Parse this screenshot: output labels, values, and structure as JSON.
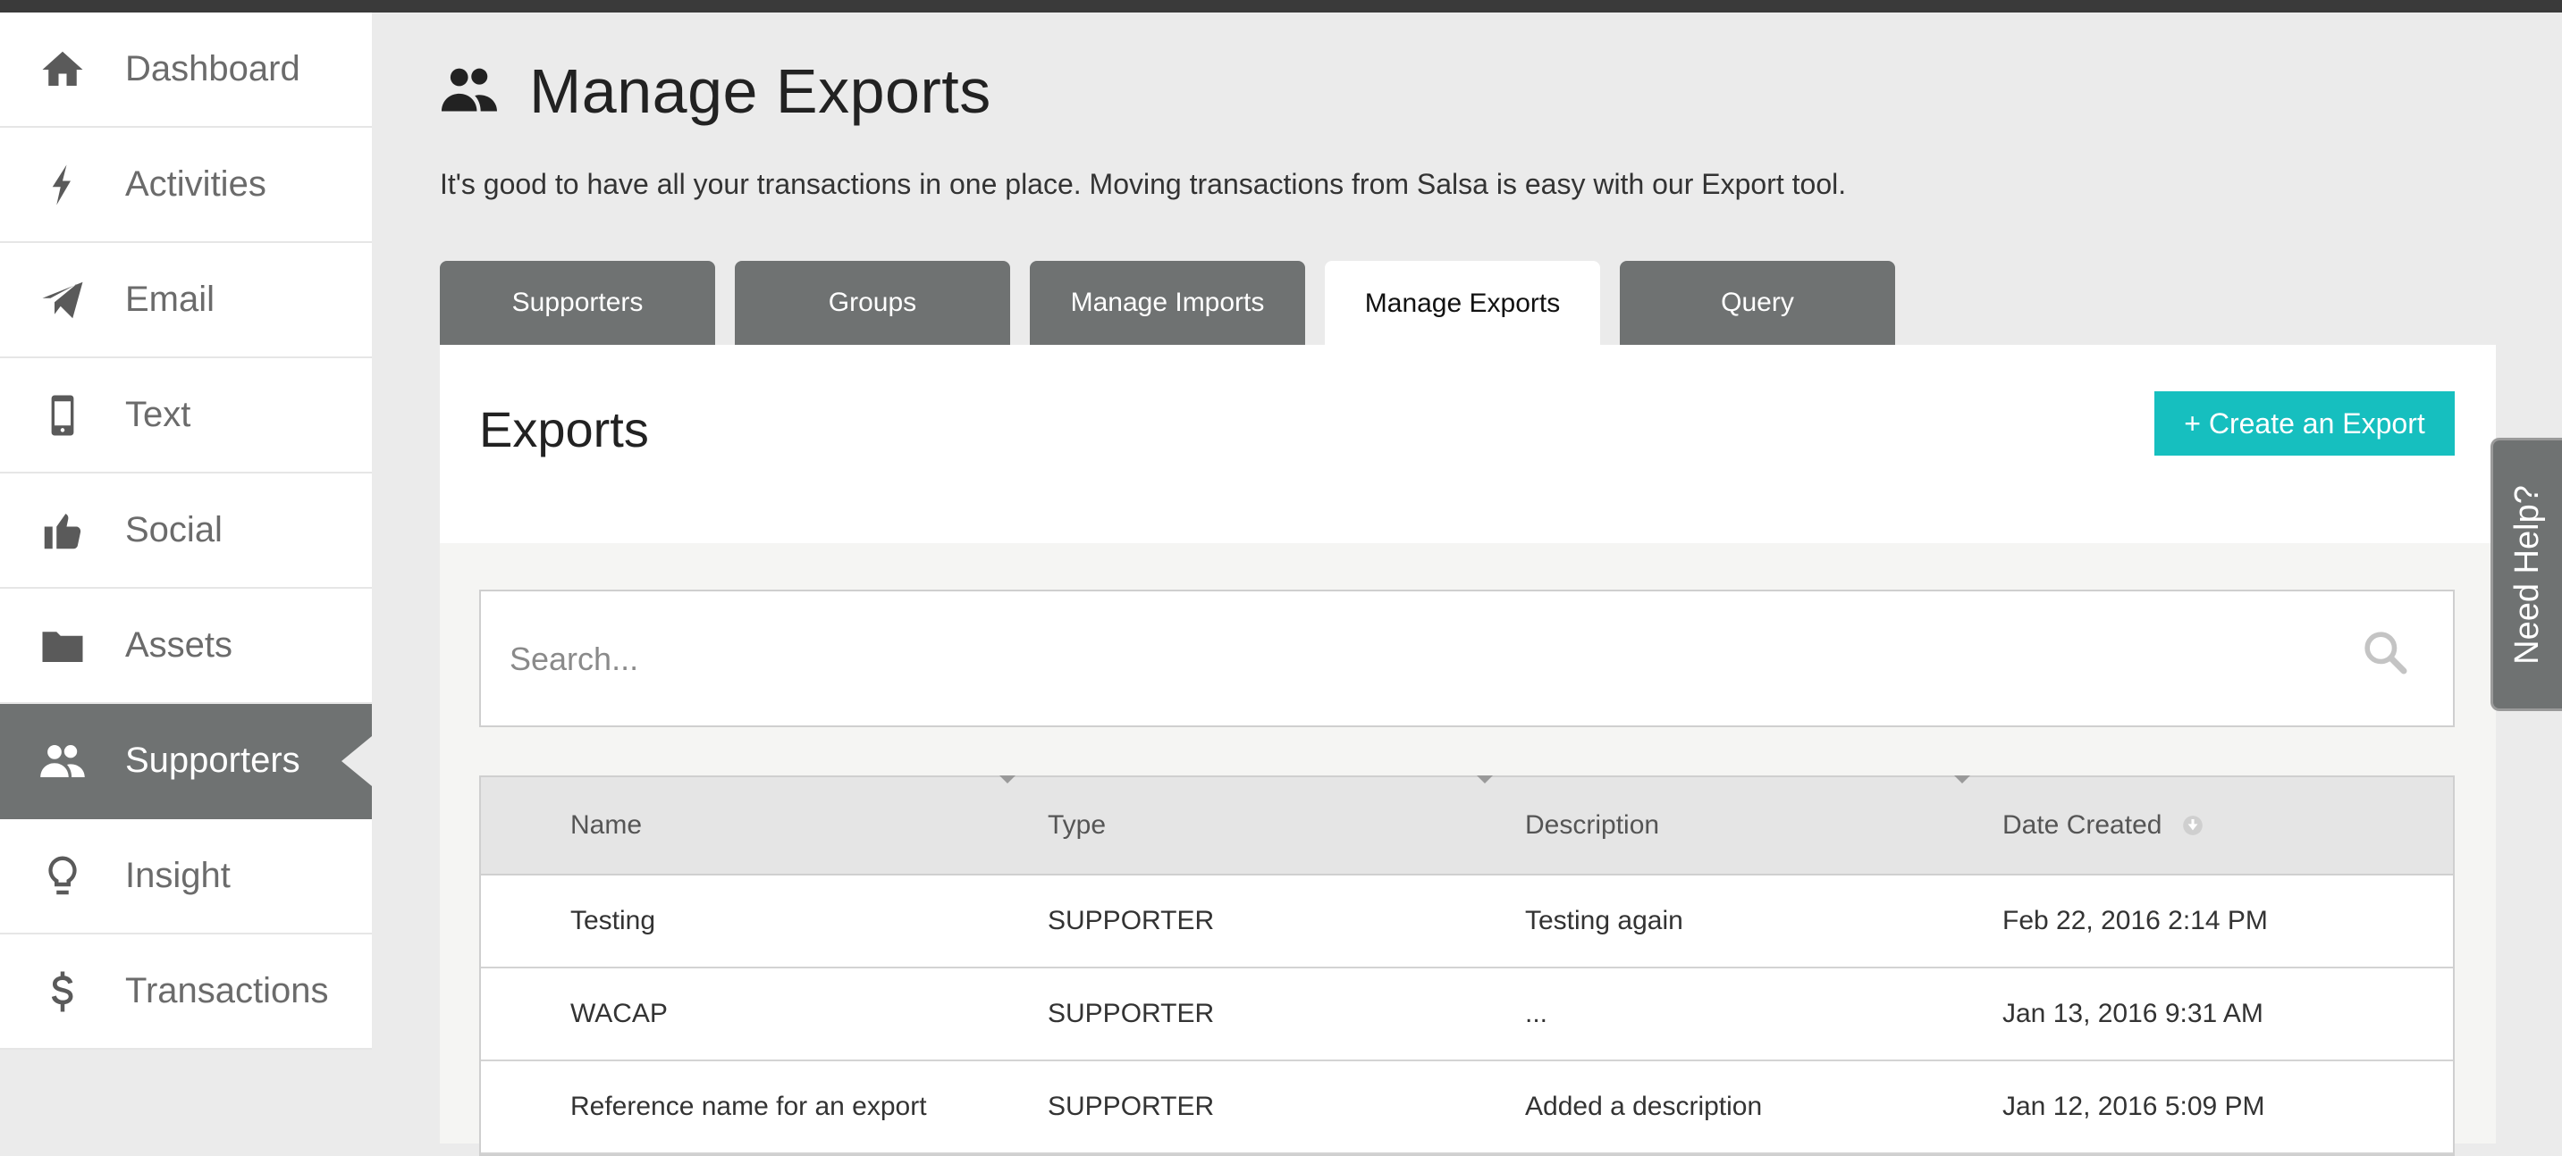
{
  "sidebar": {
    "items": [
      {
        "label": "Dashboard",
        "icon": "home-icon"
      },
      {
        "label": "Activities",
        "icon": "lightning-icon"
      },
      {
        "label": "Email",
        "icon": "paper-plane-icon"
      },
      {
        "label": "Text",
        "icon": "mobile-phone-icon"
      },
      {
        "label": "Social",
        "icon": "thumbs-up-icon"
      },
      {
        "label": "Assets",
        "icon": "folder-icon"
      },
      {
        "label": "Supporters",
        "icon": "users-icon",
        "active": true
      },
      {
        "label": "Insight",
        "icon": "lightbulb-icon"
      },
      {
        "label": "Transactions",
        "icon": "dollar-icon"
      }
    ]
  },
  "header": {
    "title": "Manage Exports",
    "icon": "users-icon",
    "description": "It's good to have all your transactions in one place. Moving transactions from Salsa is easy with our Export tool."
  },
  "tabs": [
    {
      "label": "Supporters"
    },
    {
      "label": "Groups"
    },
    {
      "label": "Manage Imports"
    },
    {
      "label": "Manage Exports",
      "active": true
    },
    {
      "label": "Query"
    }
  ],
  "panel": {
    "title": "Exports",
    "create_label": "+ Create an Export",
    "search_placeholder": "Search..."
  },
  "table": {
    "columns": [
      "Name",
      "Type",
      "Description",
      "Date Created"
    ],
    "rows": [
      [
        "Testing",
        "SUPPORTER",
        "Testing again",
        "Feb 22, 2016 2:14 PM"
      ],
      [
        "WACAP",
        "SUPPORTER",
        "...",
        "Jan 13, 2016 9:31 AM"
      ],
      [
        "Reference name for an export",
        "SUPPORTER",
        "Added a description",
        "Jan 12, 2016 5:09 PM"
      ]
    ]
  },
  "help": {
    "label": "Need Help?"
  },
  "colors": {
    "accent": "#16bfbf",
    "nav_active": "#6f7272",
    "background": "#ebebeb"
  }
}
